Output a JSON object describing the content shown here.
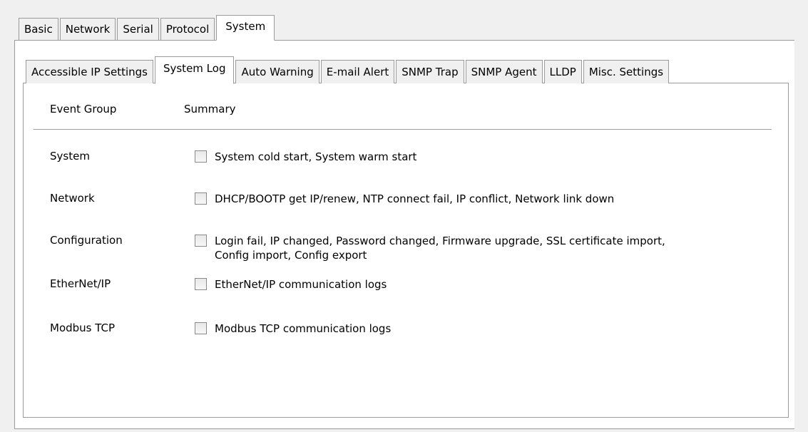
{
  "outer_tabs": {
    "items": [
      "Basic",
      "Network",
      "Serial",
      "Protocol",
      "System"
    ],
    "active_index": 4
  },
  "inner_tabs": {
    "items": [
      "Accessible IP Settings",
      "System Log",
      "Auto Warning",
      "E-mail Alert",
      "SNMP Trap",
      "SNMP Agent",
      "LLDP",
      "Misc. Settings"
    ],
    "active_index": 1
  },
  "system_log": {
    "header": {
      "event_group": "Event Group",
      "summary": "Summary"
    },
    "rows": [
      {
        "group": "System",
        "summary_lines": [
          "System cold start, System warm start"
        ],
        "checked": false
      },
      {
        "group": "Network",
        "summary_lines": [
          "DHCP/BOOTP get IP/renew, NTP connect fail, IP conflict, Network link down"
        ],
        "checked": false
      },
      {
        "group": "Configuration",
        "summary_lines": [
          "Login fail, IP changed, Password changed, Firmware upgrade, SSL certificate import,",
          "Config import, Config export"
        ],
        "checked": false
      },
      {
        "group": "EtherNet/IP",
        "summary_lines": [
          "EtherNet/IP communication logs"
        ],
        "checked": false
      },
      {
        "group": "Modbus TCP",
        "summary_lines": [
          "Modbus TCP communication logs"
        ],
        "checked": false
      }
    ]
  }
}
